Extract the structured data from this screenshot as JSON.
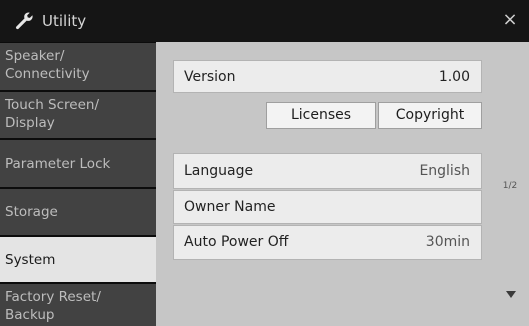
{
  "window": {
    "title": "Utility",
    "title_icon": "wrench-icon",
    "close_label": "×",
    "close_icon": "close-icon"
  },
  "sidebar": {
    "items": [
      {
        "label": "Speaker/\nConnectivity",
        "selected": false
      },
      {
        "label": "Touch Screen/\nDisplay",
        "selected": false
      },
      {
        "label": "Parameter Lock",
        "selected": false
      },
      {
        "label": "Storage",
        "selected": false
      },
      {
        "label": "System",
        "selected": true
      },
      {
        "label": "Factory Reset/\nBackup",
        "selected": false
      }
    ]
  },
  "main": {
    "version": {
      "label": "Version",
      "value": "1.00"
    },
    "buttons": {
      "licenses": "Licenses",
      "copyright": "Copyright"
    },
    "settings": [
      {
        "label": "Language",
        "value": "English"
      },
      {
        "label": "Owner Name",
        "value": ""
      },
      {
        "label": "Auto Power Off",
        "value": "30min"
      }
    ],
    "page_indicator": "1/2",
    "scroll_down_icon": "triangle-down-icon"
  },
  "colors": {
    "titlebar_bg": "#151515",
    "sidebar_item_bg": "#424242",
    "sidebar_selected_bg": "#e4e4e4",
    "content_bg": "#c6c6c6",
    "field_bg": "#ececec"
  }
}
